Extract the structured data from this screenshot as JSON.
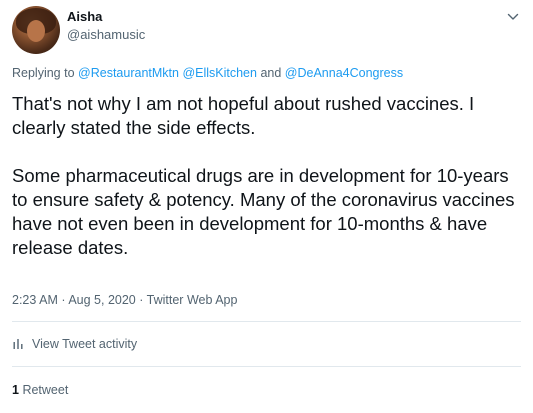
{
  "author": {
    "name": "Aisha",
    "handle": "@aishamusic"
  },
  "replying": {
    "prefix": "Replying to",
    "mentions": [
      "@RestaurantMktn",
      "@EllsKitchen",
      "@DeAnna4Congress"
    ],
    "and": "and"
  },
  "tweet": {
    "line1": "That's not why I am not hopeful about rushed vaccines. I clearly stated the side effects.",
    "line2": "Some pharmaceutical drugs are in development for 10-years to ensure safety & potency. Many of the coronavirus vaccines have not even been in development for 10-months & have release dates."
  },
  "meta": {
    "time": "2:23 AM",
    "separator": "·",
    "date": "Aug 5, 2020",
    "source": "Twitter Web App"
  },
  "activity": {
    "label": "View Tweet activity",
    "icon": "bar-chart-icon"
  },
  "stats": {
    "retweet_count": "1",
    "retweet_label": "Retweet"
  },
  "icons": {
    "menu": "chevron-down-icon"
  },
  "colors": {
    "link": "#1d9bf0",
    "secondary": "#536471",
    "divider": "#e1e8ed"
  }
}
